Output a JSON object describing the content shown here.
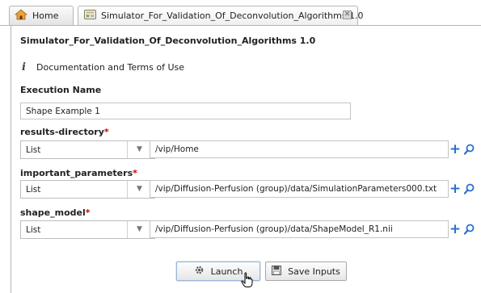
{
  "tabs": {
    "home_label": "Home",
    "simulator_label": "Simulator_For_Validation_Of_Deconvolution_Algorithms 1.0"
  },
  "app": {
    "title": "Simulator_For_Validation_Of_Deconvolution_Algorithms 1.0",
    "doc_link": "Documentation and Terms of Use"
  },
  "execution": {
    "label": "Execution Name",
    "value": "Shape Example 1"
  },
  "params": [
    {
      "label": "results-directory",
      "required": "*",
      "type": "List",
      "value": "/vip/Home"
    },
    {
      "label": "important_parameters",
      "required": "*",
      "type": "List",
      "value": "/vip/Diffusion-Perfusion (group)/data/SimulationParameters000.txt"
    },
    {
      "label": "shape_model",
      "required": "*",
      "type": "List",
      "value": "/vip/Diffusion-Perfusion (group)/data/ShapeModel_R1.nii"
    }
  ],
  "buttons": {
    "launch": "Launch",
    "save": "Save Inputs"
  },
  "colors": {
    "accent": "#2a6fd1",
    "required": "#d00000"
  },
  "icons": [
    "home-icon",
    "app-icon",
    "close-icon",
    "info-icon",
    "chevron-down-icon",
    "plus-icon",
    "search-icon",
    "gear-icon",
    "save-icon",
    "hand-cursor-icon"
  ]
}
